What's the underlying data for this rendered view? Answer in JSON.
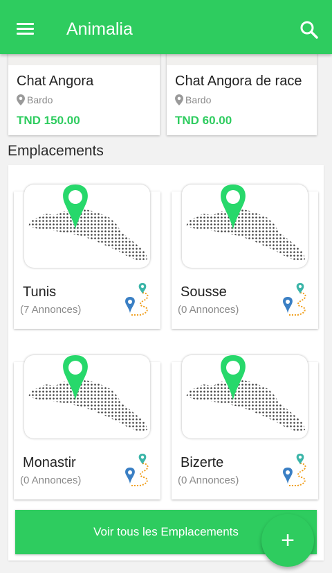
{
  "app": {
    "title": "Animalia"
  },
  "products": [
    {
      "name": "Chat Angora",
      "location": "Bardo",
      "price": "TND 150.00"
    },
    {
      "name": "Chat Angora de race",
      "location": "Bardo",
      "price": "TND 60.00"
    }
  ],
  "locations": {
    "title": "Emplacements",
    "items": [
      {
        "city": "Tunis",
        "count": "(7 Annonces)"
      },
      {
        "city": "Sousse",
        "count": "(0 Annonces)"
      },
      {
        "city": "Monastir",
        "count": "(0 Annonces)"
      },
      {
        "city": "Bizerte",
        "count": "(0 Annonces)"
      }
    ],
    "view_all_label": "Voir tous les Emplacements"
  },
  "fab": {
    "icon": "plus-icon",
    "label": "+"
  },
  "colors": {
    "primary": "#2ecc5f",
    "muted_text": "#8a8a8a",
    "pin_blue": "#3a7fc4",
    "pin_teal": "#3bb5a8",
    "route_orange": "#f0a020"
  },
  "icons": {
    "menu": "menu-icon",
    "search": "search-icon",
    "location": "location-pin-icon",
    "route": "route-icon"
  }
}
